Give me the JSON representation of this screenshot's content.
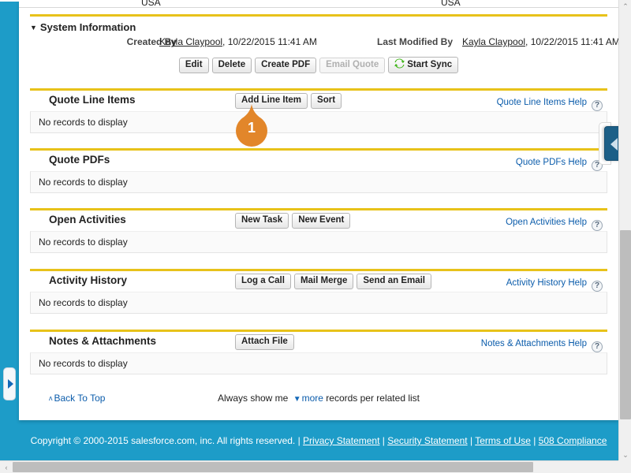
{
  "top_cutoff_row": {
    "left_value": "USA",
    "right_value": "USA"
  },
  "system_information": {
    "section_title": "System Information",
    "collapse_caret": "▼",
    "created_by": {
      "label": "Created By",
      "link": "Kayla Claypool",
      "rest": ", 10/22/2015 11:41 AM"
    },
    "last_modified_by": {
      "label": "Last Modified By",
      "link": "Kayla Claypool",
      "rest": ", 10/22/2015 11:41 AM"
    },
    "buttons": [
      {
        "label": "Edit",
        "disabled": false
      },
      {
        "label": "Delete",
        "disabled": false
      },
      {
        "label": "Create PDF",
        "disabled": false
      },
      {
        "label": "Email Quote",
        "disabled": true
      },
      {
        "label": "Start Sync",
        "disabled": false,
        "icon": "sync-arrows-icon"
      }
    ]
  },
  "related_lists": [
    {
      "title": "Quote Line Items",
      "buttons": [
        "Add Line Item",
        "Sort"
      ],
      "help_label": "Quote Line Items Help",
      "help_icon": "?",
      "empty_text": "No records to display"
    },
    {
      "title": "Quote PDFs",
      "buttons": [],
      "help_label": "Quote PDFs Help",
      "help_icon": "?",
      "empty_text": "No records to display"
    },
    {
      "title": "Open Activities",
      "buttons": [
        "New Task",
        "New Event"
      ],
      "help_label": "Open Activities Help",
      "help_icon": "?",
      "empty_text": "No records to display"
    },
    {
      "title": "Activity History",
      "buttons": [
        "Log a Call",
        "Mail Merge",
        "Send an Email"
      ],
      "help_label": "Activity History Help",
      "help_icon": "?",
      "empty_text": "No records to display"
    },
    {
      "title": "Notes & Attachments",
      "buttons": [
        "Attach File"
      ],
      "help_label": "Notes & Attachments Help",
      "help_icon": "?",
      "empty_text": "No records to display"
    }
  ],
  "card_footer": {
    "back_to_top": "Back To Top",
    "back_caret": "ʌ",
    "show_more_prefix": "Always show me ",
    "show_more_caret": "▼",
    "show_more_link": "more",
    "show_more_suffix": " records per related list"
  },
  "copyright": {
    "text": "Copyright © 2000-2015 salesforce.com, inc. All rights reserved. | ",
    "links": [
      "Privacy Statement",
      "Security Statement",
      "Terms of Use",
      "508 Compliance"
    ],
    "separator": " | "
  },
  "marker": {
    "number": "1"
  },
  "colors": {
    "page_blue": "#1d9cc8",
    "gold_rule": "#e8c21a",
    "link_blue": "#0b5cab",
    "marker_orange": "#e2862a",
    "sync_green": "#3fb618",
    "right_tab_blue": "#1c5f87"
  },
  "scrollbars": {
    "vertical_arrow_up": "⌃",
    "vertical_arrow_down": "⌄",
    "horizontal_arrow_left": "‹",
    "horizontal_arrow_right": "›"
  },
  "side_tabs": {
    "right_tab_icon": "◀",
    "left_tab_icon": "▶"
  }
}
